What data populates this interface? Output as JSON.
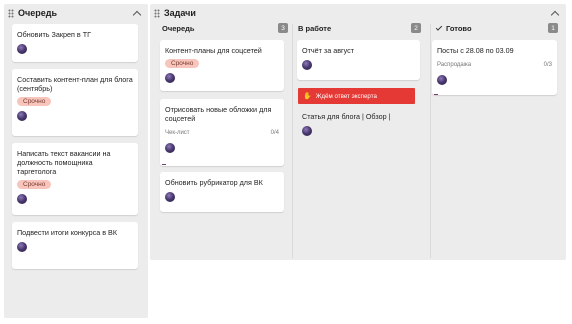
{
  "queue_panel": {
    "title": "Очередь",
    "cards": [
      {
        "title": "Обновить Закреп в ТГ"
      },
      {
        "title": "Составить контент-план для блога (сентябрь)",
        "badge": "Срочно"
      },
      {
        "title": "Написать текст вакансии на должность помощника таргетолога",
        "badge": "Срочно"
      },
      {
        "title": "Подвести итоги конкурса в ВК"
      }
    ]
  },
  "tasks_panel": {
    "title": "Задачи",
    "columns": [
      {
        "title": "Очередь",
        "count": "3",
        "cards": [
          {
            "title": "Контент-планы для соцсетей",
            "badge": "Срочно"
          },
          {
            "title": "Отрисовать новые обложки для соцсетей",
            "checklist_label": "Чек-лист",
            "checklist_progress": "0/4",
            "progress": 0
          },
          {
            "title": "Обновить рубрикатор для ВК"
          }
        ]
      },
      {
        "title": "В работе",
        "count": "2",
        "cards": [
          {
            "title": "Отчёт за август"
          },
          {
            "title": "Статья для блога | Обзор |",
            "banner": "Ждём ответ эксперта",
            "banner_icon": "hand-icon"
          }
        ]
      },
      {
        "title": "Готово",
        "count": "1",
        "cards": [
          {
            "title": "Посты с 28.08 по 03.09",
            "checklist_label": "Распродажа",
            "checklist_progress": "0/3",
            "progress": 0
          }
        ]
      }
    ]
  },
  "colors": {
    "panel_bg": "#ececec",
    "badge_bg": "#f7c5bb",
    "banner_bg": "#e53935",
    "count_bg": "#8a8a8a"
  }
}
